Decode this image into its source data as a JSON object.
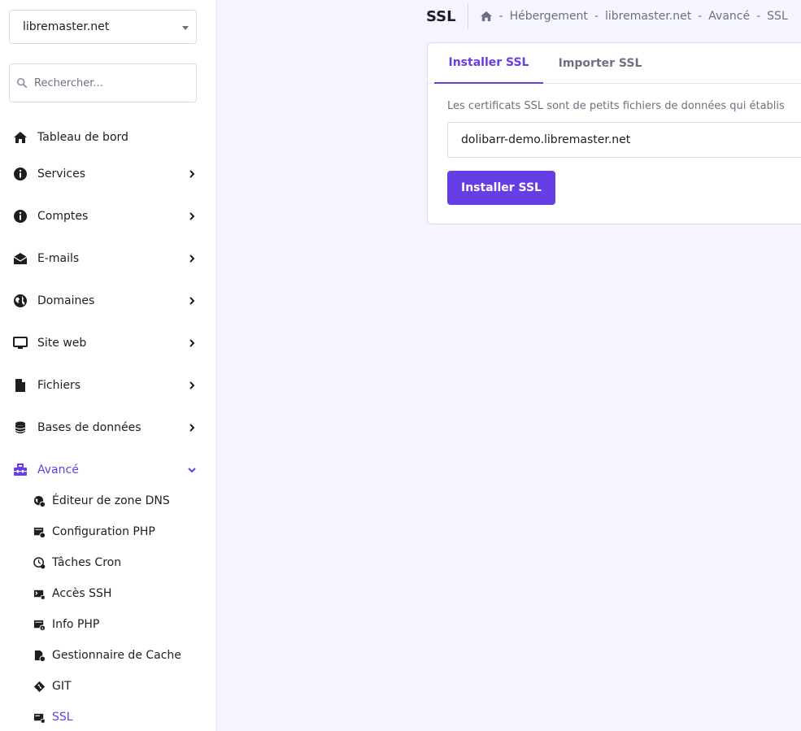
{
  "domain_selector": {
    "value": "libremaster.net"
  },
  "search": {
    "placeholder": "Rechercher..."
  },
  "sidebar": {
    "items": [
      {
        "label": "Tableau de bord",
        "icon": "home-icon"
      },
      {
        "label": "Services",
        "icon": "info-icon"
      },
      {
        "label": "Comptes",
        "icon": "info-icon"
      },
      {
        "label": "E-mails",
        "icon": "envelope-icon"
      },
      {
        "label": "Domaines",
        "icon": "globe-icon"
      },
      {
        "label": "Site web",
        "icon": "monitor-icon"
      },
      {
        "label": "Fichiers",
        "icon": "file-icon"
      },
      {
        "label": "Bases de données",
        "icon": "database-icon"
      },
      {
        "label": "Avancé",
        "icon": "toolbox-icon",
        "expanded": true
      }
    ],
    "sub_items": [
      {
        "label": "Éditeur de zone DNS",
        "icon": "dns-icon"
      },
      {
        "label": "Configuration PHP",
        "icon": "php-config-icon"
      },
      {
        "label": "Tâches Cron",
        "icon": "clock-icon"
      },
      {
        "label": "Accès SSH",
        "icon": "ssh-icon"
      },
      {
        "label": "Info PHP",
        "icon": "php-info-icon"
      },
      {
        "label": "Gestionnaire de Cache",
        "icon": "cache-icon"
      },
      {
        "label": "GIT",
        "icon": "git-icon"
      },
      {
        "label": "SSL",
        "icon": "ssl-icon",
        "active": true
      }
    ]
  },
  "header": {
    "title": "SSL",
    "breadcrumb": [
      "Hébergement",
      "libremaster.net",
      "Avancé",
      "SSL"
    ],
    "separator": "-"
  },
  "main": {
    "tabs": [
      {
        "label": "Installer SSL",
        "active": true
      },
      {
        "label": "Importer SSL",
        "active": false
      }
    ],
    "description": "Les certificats SSL sont de petits fichiers de données qui établis",
    "domain_field": {
      "value": "dolibarr-demo.libremaster.net"
    },
    "install_button": "Installer SSL"
  },
  "colors": {
    "accent": "#673de6",
    "text": "#1d1e20",
    "muted": "#6d7081",
    "background": "#f4f5ff"
  }
}
